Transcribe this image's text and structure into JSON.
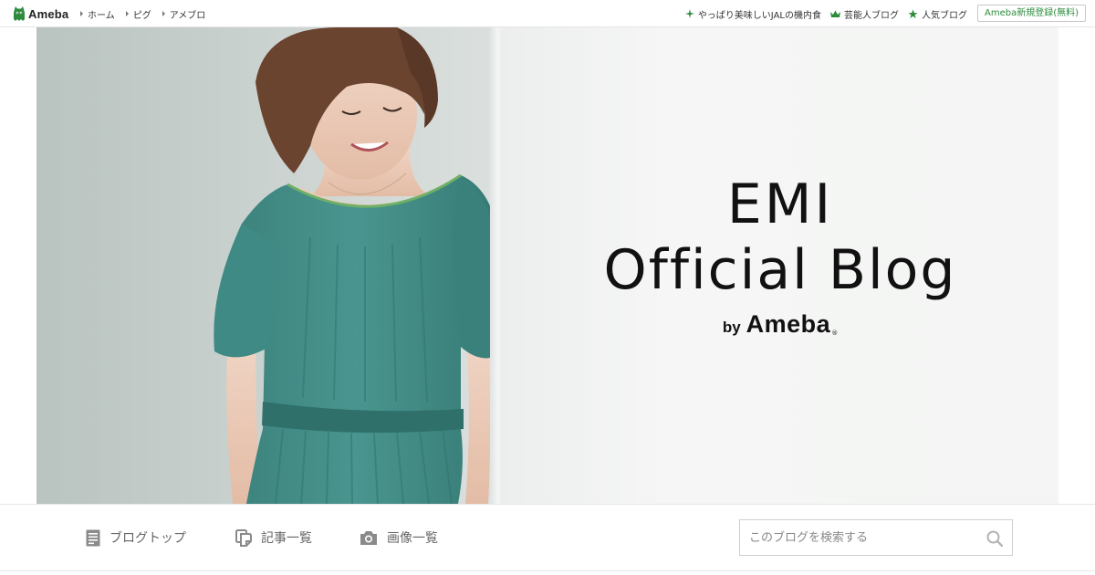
{
  "header": {
    "logo_text": "Ameba",
    "nav": [
      {
        "label": "ホーム"
      },
      {
        "label": "ピグ"
      },
      {
        "label": "アメブロ"
      }
    ],
    "right_links": [
      {
        "label": "やっぱり美味しいJALの機内食",
        "icon": "sparkle-icon"
      },
      {
        "label": "芸能人ブログ",
        "icon": "crown-icon"
      },
      {
        "label": "人気ブログ",
        "icon": "star-icon"
      }
    ],
    "register_label": "Ameba新規登録(無料)"
  },
  "hero": {
    "title_line1": "EMI",
    "title_line2": "Official Blog",
    "by": "by",
    "brand": "Ameba",
    "registered_mark": "®"
  },
  "blognav": {
    "items": [
      {
        "label": "ブログトップ",
        "icon": "document-icon"
      },
      {
        "label": "記事一覧",
        "icon": "copy-icon"
      },
      {
        "label": "画像一覧",
        "icon": "camera-icon"
      }
    ],
    "search": {
      "placeholder": "このブログを検索する",
      "value": ""
    }
  },
  "colors": {
    "brand_green": "#2d8c3c",
    "dress_teal": "#3f8a85",
    "nav_gray": "#666666"
  }
}
